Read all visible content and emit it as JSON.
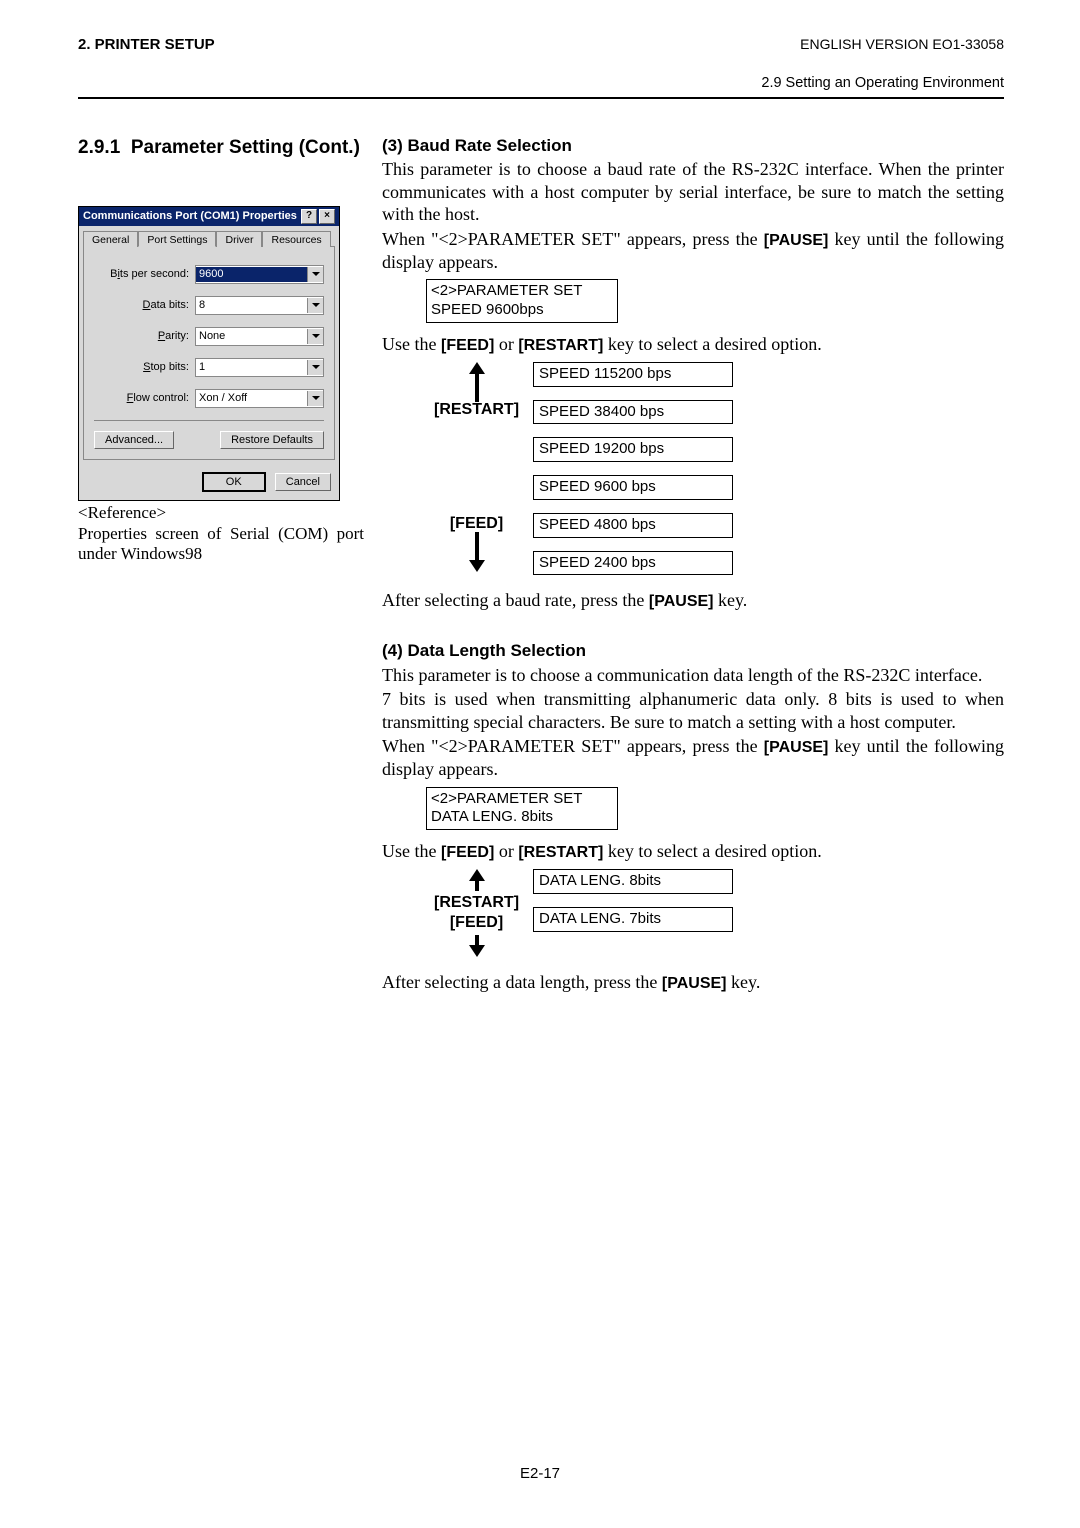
{
  "header": {
    "chapter": "2. PRINTER SETUP",
    "doc_id": "ENGLISH VERSION EO1-33058",
    "section_path": "2.9 Setting an Operating Environment"
  },
  "left": {
    "section_number": "2.9.1",
    "section_title": "Parameter Setting (Cont.)",
    "reference_label": "<Reference>",
    "reference_text": "Properties screen of Serial (COM) port under Windows98"
  },
  "dialog": {
    "title": "Communications Port (COM1) Properties",
    "tabs": [
      "General",
      "Port Settings",
      "Driver",
      "Resources"
    ],
    "fields": {
      "bits_per_second": {
        "label_pre": "B",
        "label_ul": "i",
        "label_post": "ts per second:",
        "value": "9600"
      },
      "data_bits": {
        "label_ul": "D",
        "label_post": "ata bits:",
        "value": "8"
      },
      "parity": {
        "label_ul": "P",
        "label_post": "arity:",
        "value": "None"
      },
      "stop_bits": {
        "label_ul": "S",
        "label_post": "top bits:",
        "value": "1"
      },
      "flow_control": {
        "label_ul": "F",
        "label_post": "low control:",
        "value": "Xon / Xoff"
      }
    },
    "buttons": {
      "advanced": "Advanced...",
      "restore": "Restore Defaults",
      "ok": "OK",
      "cancel": "Cancel"
    }
  },
  "section3": {
    "title": "(3)  Baud Rate Selection",
    "p1": "This parameter is to choose a baud rate of the RS-232C interface.  When the printer communicates with a host computer by serial interface, be sure to match the setting with the host.",
    "p2_a": "When \"<2>PARAMETER SET\" appears, press the ",
    "p2_key": "[PAUSE]",
    "p2_b": " key until the following display appears.",
    "lcd": {
      "line1": "<2>PARAMETER SET",
      "line2": "SPEED  9600bps"
    },
    "feed_restart_a": "Use the ",
    "key_feed": "[FEED]",
    "feed_restart_b": " or ",
    "key_restart": "[RESTART]",
    "feed_restart_c": " key to select a desired option.",
    "nav": {
      "restart": "[RESTART]",
      "feed": "[FEED]"
    },
    "options": [
      "SPEED  115200 bps",
      "SPEED  38400 bps",
      "SPEED  19200 bps",
      "SPEED   9600 bps",
      "SPEED   4800 bps",
      "SPEED   2400 bps"
    ],
    "after_a": "After selecting a baud rate, press the ",
    "after_key": "[PAUSE]",
    "after_b": " key."
  },
  "section4": {
    "title": "(4)  Data Length Selection",
    "p1": "This parameter is to choose a communication data length of the RS-232C interface.",
    "p2": "7 bits is used when transmitting alphanumeric data only.  8 bits is used to when transmitting special characters.  Be sure to match a setting with a host computer.",
    "p3_a": "When \"<2>PARAMETER SET\" appears, press the ",
    "p3_key": "[PAUSE]",
    "p3_b": " key until the following display appears.",
    "lcd": {
      "line1": "<2>PARAMETER SET",
      "line2": "DATA LENG. 8bits"
    },
    "feed_restart_a": "Use the ",
    "key_feed": "[FEED]",
    "feed_restart_b": " or ",
    "key_restart": "[RESTART]",
    "feed_restart_c": " key to select a desired option.",
    "nav": {
      "restart": "[RESTART]",
      "feed": "[FEED]"
    },
    "options": [
      "DATA LENG. 8bits",
      "DATA LENG. 7bits"
    ],
    "after_a": "After selecting a data length, press the ",
    "after_key": "[PAUSE]",
    "after_b": " key."
  },
  "footer": {
    "page": "E2-17"
  }
}
